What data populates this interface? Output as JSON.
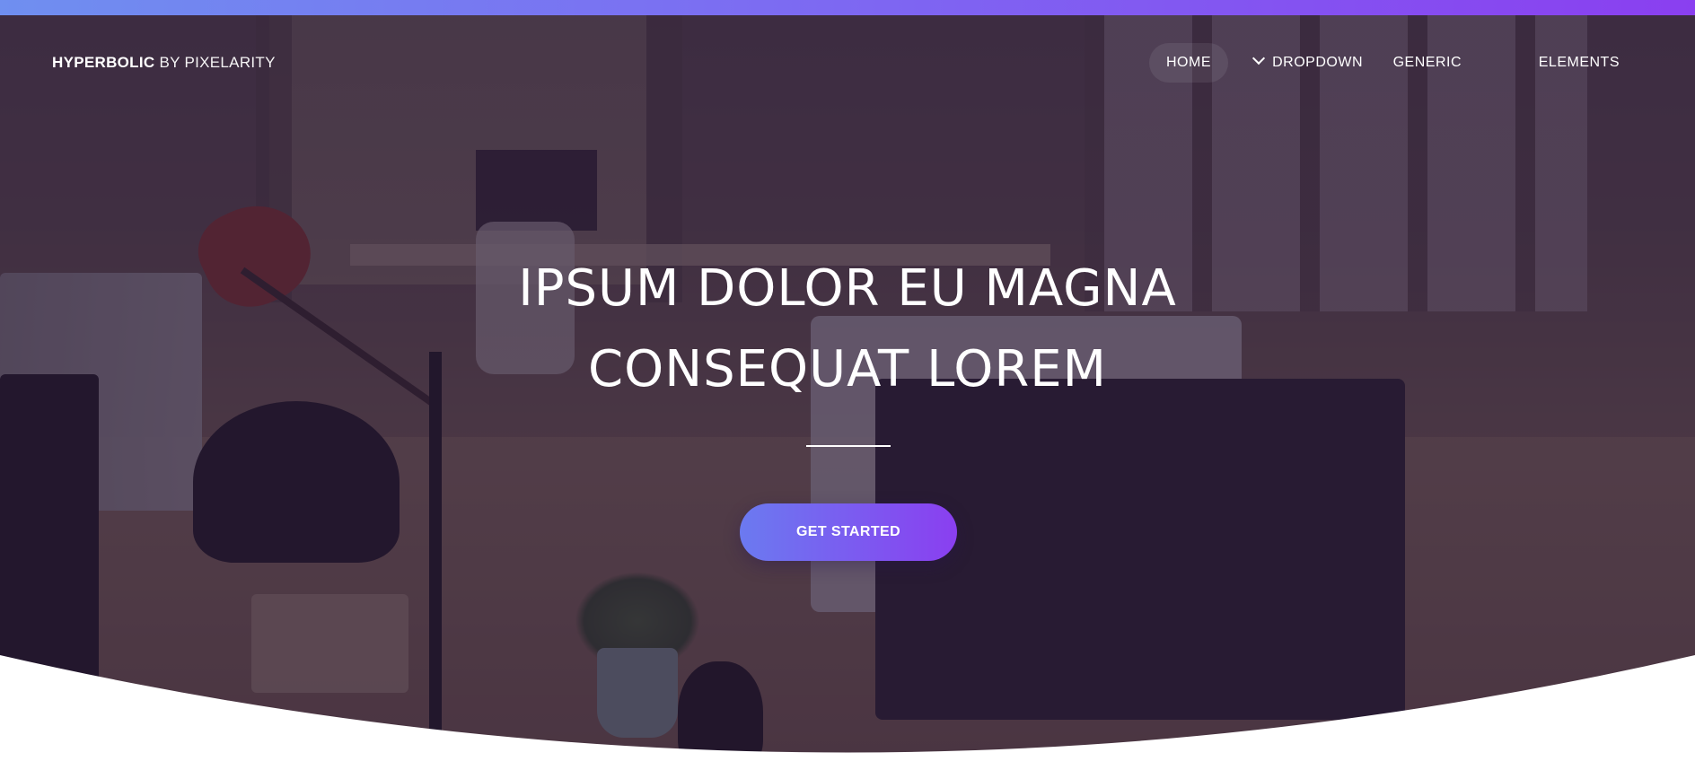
{
  "brand": {
    "name_strong": "HYPERBOLIC",
    "name_light": " BY PIXELARITY"
  },
  "nav": {
    "items": [
      {
        "label": "HOME",
        "active": true
      },
      {
        "label": "DROPDOWN",
        "icon": "chevron-down-icon"
      },
      {
        "label": "GENERIC"
      },
      {
        "label": "ELEMENTS"
      }
    ]
  },
  "hero": {
    "title_line1": "IPSUM DOLOR EU MAGNA",
    "title_line2": "CONSEQUAT LOREM",
    "cta_label": "GET STARTED",
    "background_image": "office workspace photo"
  },
  "colors": {
    "accent_start": "#6b7af0",
    "accent_end": "#8a3ff0",
    "overlay": "#26163 4",
    "text": "#ffffff"
  }
}
